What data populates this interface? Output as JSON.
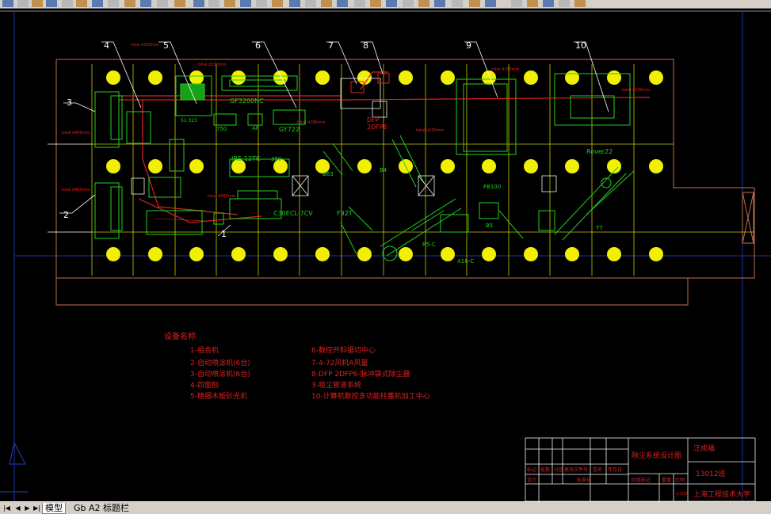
{
  "app": {
    "window": "AutoCAD drawing"
  },
  "tabs": {
    "model": "模型",
    "layout1": "Gb A2 标题栏"
  },
  "callouts": [
    "1",
    "2",
    "3",
    "4",
    "5",
    "6",
    "7",
    "8",
    "9",
    "10"
  ],
  "equipment_labels": {
    "gf3200": "GF3200NC",
    "l51": "51 323",
    "gy722": "GY722",
    "e750": "750",
    "af": "AF",
    "dfp": "DFP",
    "dfp2": "2DFP6",
    "jr": "JRS-12TK",
    "k38": "380",
    "b63": "B63",
    "b4": "B4",
    "fb100": "FB100",
    "rover": "Rover22",
    "c30": "C30ECL-7CV",
    "f92": "F92T",
    "r5": "R5-C",
    "a16": "A16-C",
    "b5": "B5",
    "t7": "T7"
  },
  "legend": {
    "title": "设备名称",
    "left": [
      "1-组合机",
      "2-自动喷涂机(6台)",
      "3-自动喷涂机(6台)",
      "4-四面刨",
      "5-精细木板砂光机"
    ],
    "right": [
      "6-数控开料锯切中心",
      "7-4-72风机A风量",
      "8-DFP 2DFP6-脉冲袋式除尘器",
      "3-吸尘管道系统",
      "10-计算机数控多功能柱塞机加工中心"
    ]
  },
  "titleblock": {
    "drawing_title": "除尘系统设计图",
    "author": "汪成福",
    "number": "13012班",
    "school": "上海工程技术大学",
    "row1": [
      "标记",
      "处数",
      "分区",
      "更改文件号",
      "签名",
      "年月日"
    ],
    "row2": [
      "设计",
      "标准化"
    ],
    "row3": [
      "阶段标记",
      "重量",
      "比例"
    ],
    "scale": "1:100"
  }
}
